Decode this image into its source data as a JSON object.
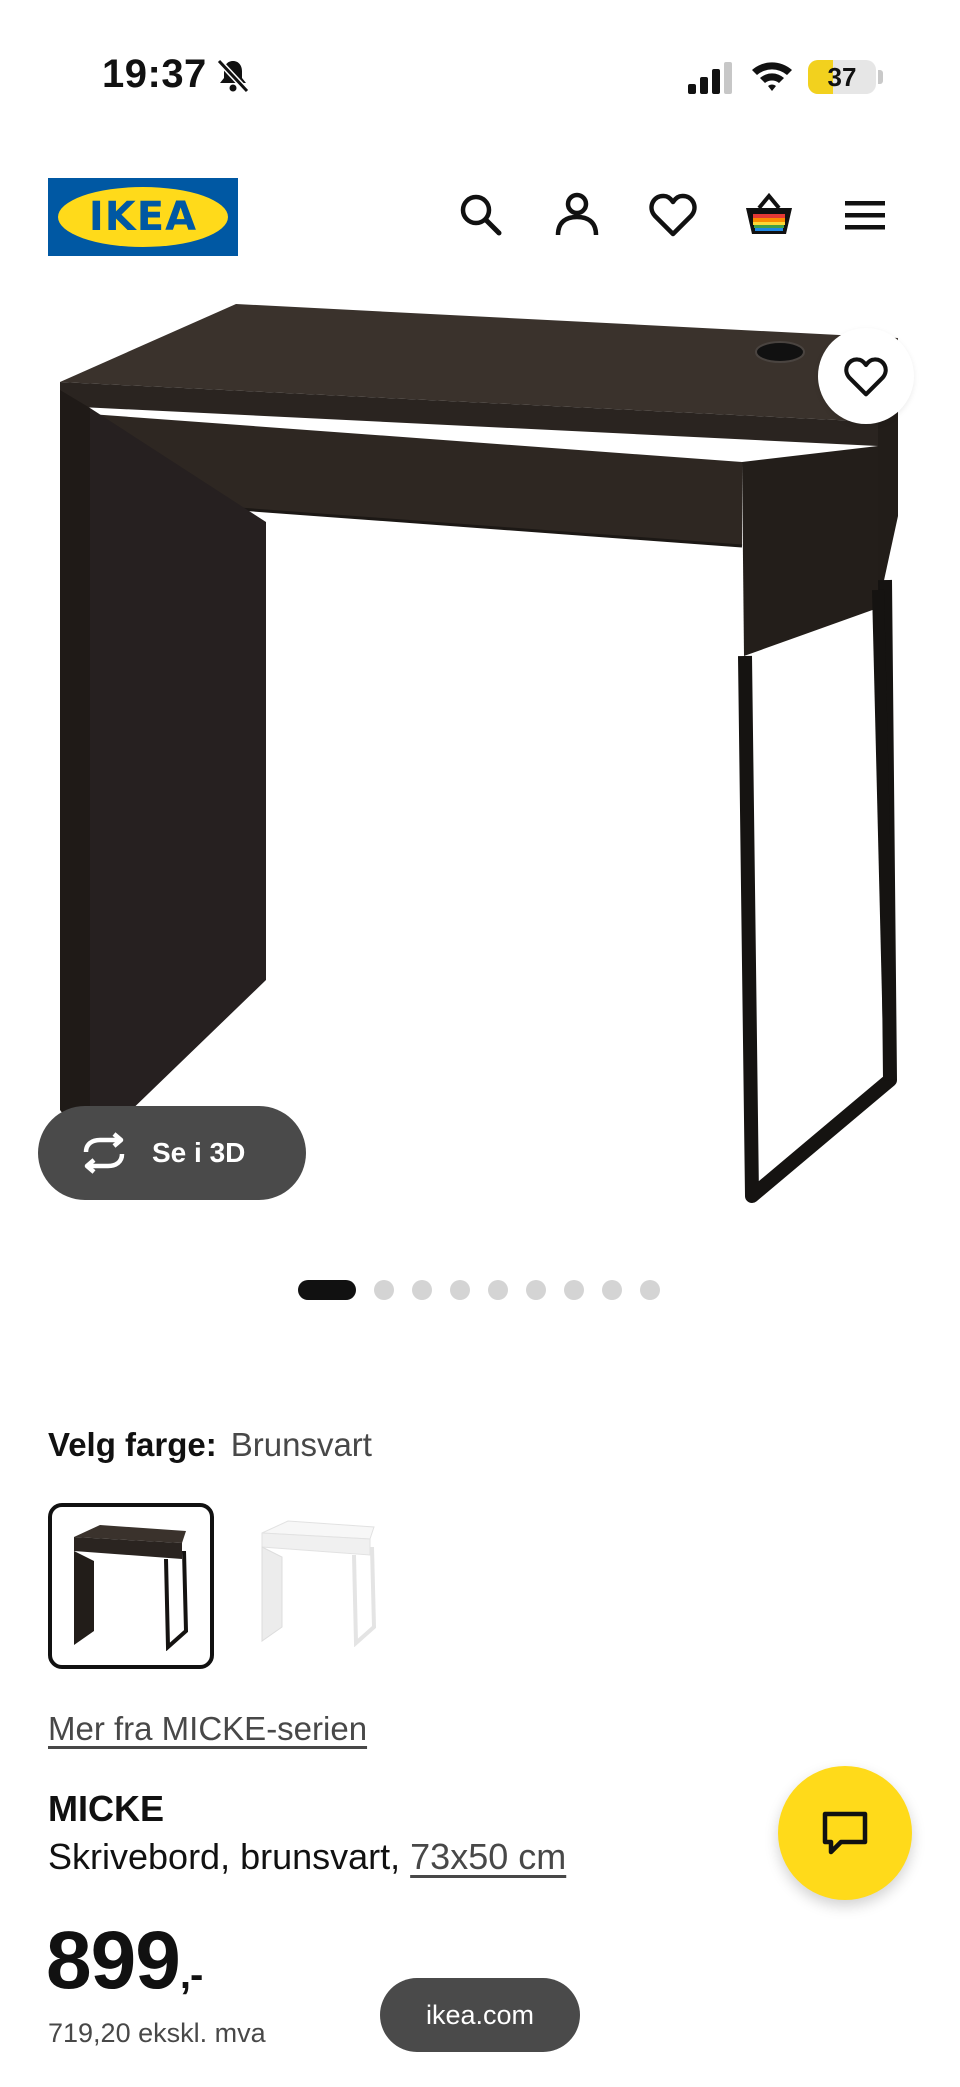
{
  "status_bar": {
    "time": "19:37",
    "battery": "37",
    "battery_level": 0.37,
    "icons": [
      "bell-slash-icon",
      "cellular-signal-icon",
      "wifi-icon",
      "battery-icon"
    ]
  },
  "header": {
    "logo_text": "IKEA",
    "icons": [
      "search-icon",
      "account-icon",
      "heart-icon",
      "shopping-bag-icon",
      "menu-icon"
    ],
    "logo_colors": {
      "blue": "#0058a3",
      "yellow": "#ffda1a"
    }
  },
  "gallery": {
    "see_in_3d_label": "Se i 3D",
    "image_count": 9,
    "active_index": 0
  },
  "color_select": {
    "label": "Velg farge:",
    "value": "Brunsvart",
    "options": [
      {
        "name": "brunsvart",
        "color": "#2b2520",
        "selected": true
      },
      {
        "name": "hvit",
        "color": "#f2f2f2",
        "selected": false
      }
    ]
  },
  "series_link": "Mer fra MICKE-serien",
  "product": {
    "name": "MICKE",
    "description": "Skrivebord, brunsvart, ",
    "size": "73x50 cm",
    "price": "899",
    "price_suffix": ",-",
    "price_ex_vat": "719,20 ekskl. mva"
  },
  "url_bar": "ikea.com",
  "colors": {
    "accent_yellow": "#ffda1a",
    "dark_pill": "#4a4a4a",
    "text_primary": "#111111",
    "text_secondary": "#484848"
  }
}
